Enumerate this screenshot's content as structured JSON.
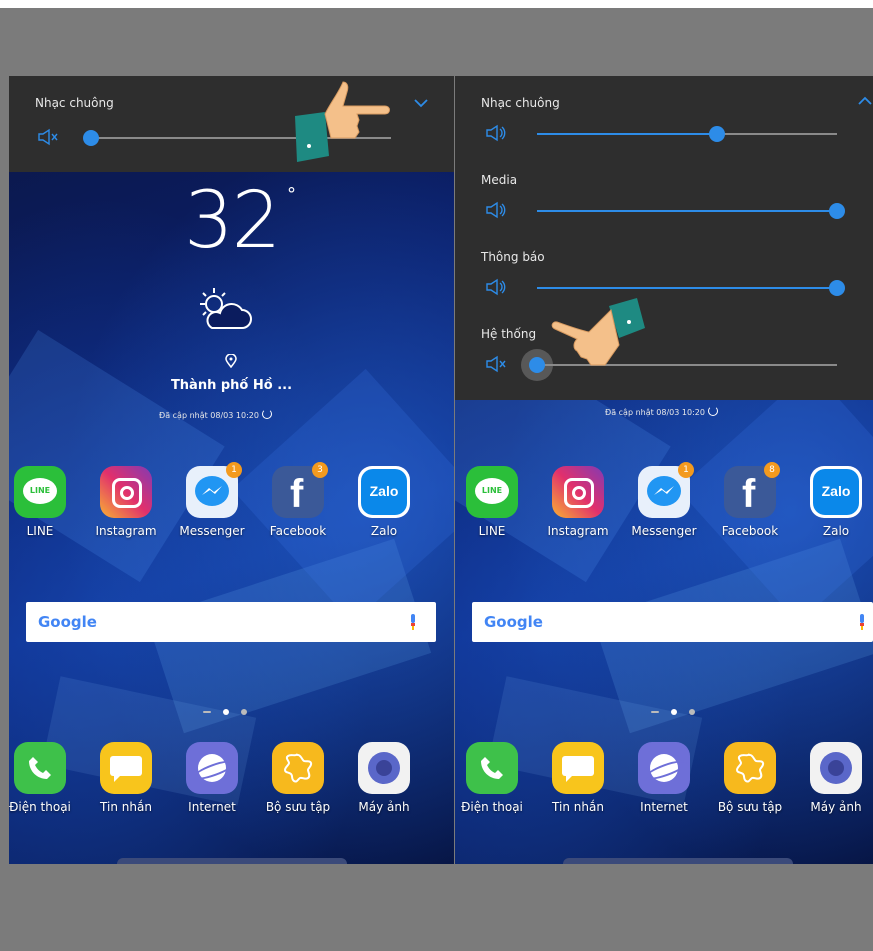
{
  "left_screen": {
    "volume": {
      "label": "Nhạc chuông",
      "level": 0.0
    },
    "weather": {
      "temperature": "32",
      "degree": "°",
      "city": "Thành phố Hồ ...",
      "updated": "Đã cập nhật 08/03 10:20"
    },
    "apps": [
      {
        "label": "LINE",
        "icon": "line-icon",
        "badge": ""
      },
      {
        "label": "Instagram",
        "icon": "instagram-icon",
        "badge": ""
      },
      {
        "label": "Messenger",
        "icon": "messenger-icon",
        "badge": "1"
      },
      {
        "label": "Facebook",
        "icon": "facebook-icon",
        "badge": "3"
      },
      {
        "label": "Zalo",
        "icon": "zalo-icon",
        "badge": ""
      }
    ],
    "search": {
      "brand": "Google"
    },
    "dock": [
      {
        "label": "Điện thoại",
        "icon": "phone-icon"
      },
      {
        "label": "Tin nhắn",
        "icon": "messages-icon"
      },
      {
        "label": "Internet",
        "icon": "internet-icon"
      },
      {
        "label": "Bộ sưu tập",
        "icon": "gallery-icon"
      },
      {
        "label": "Máy ảnh",
        "icon": "camera-icon"
      }
    ]
  },
  "right_screen": {
    "volume_sliders": [
      {
        "label": "Nhạc chuông",
        "level": 0.6
      },
      {
        "label": "Media",
        "level": 1.0
      },
      {
        "label": "Thông báo",
        "level": 1.0
      },
      {
        "label": "Hệ thống",
        "level": 0.0
      }
    ],
    "updated": "Đã cập nhật 08/03 10:20",
    "apps": [
      {
        "label": "LINE",
        "icon": "line-icon",
        "badge": ""
      },
      {
        "label": "Instagram",
        "icon": "instagram-icon",
        "badge": ""
      },
      {
        "label": "Messenger",
        "icon": "messenger-icon",
        "badge": "1"
      },
      {
        "label": "Facebook",
        "icon": "facebook-icon",
        "badge": "8"
      },
      {
        "label": "Zalo",
        "icon": "zalo-icon",
        "badge": ""
      }
    ],
    "search": {
      "brand": "Google"
    },
    "dock": [
      {
        "label": "Điện thoại",
        "icon": "phone-icon"
      },
      {
        "label": "Tin nhắn",
        "icon": "messages-icon"
      },
      {
        "label": "Internet",
        "icon": "internet-icon"
      },
      {
        "label": "Bộ sưu tập",
        "icon": "gallery-icon"
      },
      {
        "label": "Máy ảnh",
        "icon": "camera-icon"
      }
    ]
  },
  "colors": {
    "accent": "#2d8ce8",
    "sheet": "#2e2e2e",
    "badge": "#f39a1e",
    "frame": "#7b7b7b"
  }
}
